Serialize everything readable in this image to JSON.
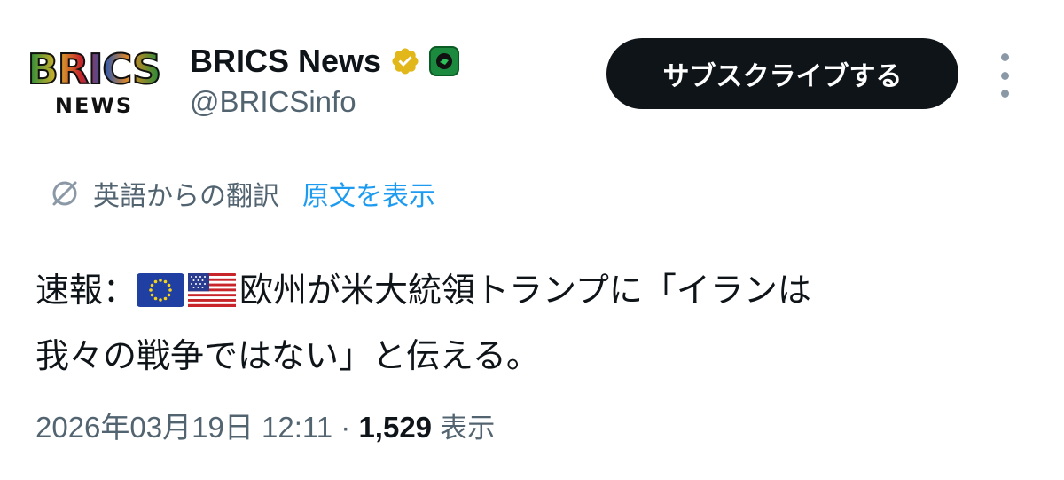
{
  "author": {
    "avatar_text_top": "BRICS",
    "avatar_text_bottom": "NEWS",
    "display_name": "BRICS News",
    "handle": "@BRICSinfo",
    "verified_icon": "verified-badge-gold",
    "affiliate_icon": "affiliate-badge-green"
  },
  "actions": {
    "subscribe_label": "サブスクライブする",
    "more_icon": "more-vertical-icon"
  },
  "translation": {
    "icon": "translate-icon",
    "translated_from": "英語からの翻訳",
    "show_original": "原文を表示"
  },
  "tweet": {
    "line1_prefix": "速報：",
    "flags": [
      "eu-flag",
      "us-flag"
    ],
    "line1_text": "欧州が米大統領トランプに「イランは",
    "line2_text": "我々の戦争ではない」と伝える。"
  },
  "meta": {
    "timestamp": "2026年03月19日 12:11",
    "separator": " · ",
    "views_count": "1,529",
    "views_label": "表示"
  },
  "colors": {
    "text_primary": "#0f1419",
    "text_secondary": "#536471",
    "link": "#1d9bf0",
    "subscribe_bg": "#0f1419",
    "verified_gold": "#e2b719"
  }
}
